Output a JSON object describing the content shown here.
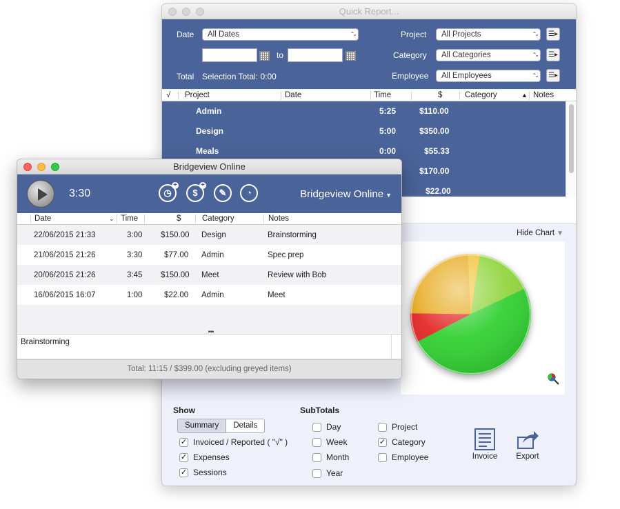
{
  "quick_report": {
    "title": "Quick Report...",
    "filters": {
      "date_label": "Date",
      "date_value": "All Dates",
      "to_label": "to",
      "total_label": "Total",
      "selection_total": "Selection Total: 0:00",
      "project_label": "Project",
      "project_value": "All Projects",
      "category_label": "Category",
      "category_value": "All Categories",
      "employee_label": "Employee",
      "employee_value": "All Employees"
    },
    "columns": {
      "check": "√",
      "project": "Project",
      "date": "Date",
      "time": "Time",
      "amount": "$",
      "category": "Category",
      "notes": "Notes"
    },
    "rows": [
      {
        "project": "Admin",
        "time": "5:25",
        "amount": "$110.00"
      },
      {
        "project": "Design",
        "time": "5:00",
        "amount": "$350.00"
      },
      {
        "project": "Meals",
        "time": "0:00",
        "amount": "$55.33"
      },
      {
        "project": "",
        "time": "",
        "amount": "$170.00"
      },
      {
        "project": "",
        "time": "",
        "amount": "$22.00"
      }
    ],
    "hide_chart": "Hide Chart",
    "chart_data": {
      "type": "pie",
      "values": [
        110,
        350,
        55.33,
        170,
        22
      ],
      "colors": [
        "#8fd43a",
        "#2ecf2e",
        "#e32222",
        "#e7a91a",
        "#f1c232"
      ]
    },
    "show": {
      "title": "Show",
      "summary": "Summary",
      "details": "Details",
      "invoiced": "Invoiced / Reported ( \"√\" )",
      "expenses": "Expenses",
      "sessions": "Sessions"
    },
    "subtotals": {
      "title": "SubTotals",
      "day": "Day",
      "week": "Week",
      "month": "Month",
      "year": "Year",
      "project": "Project",
      "category": "Category",
      "employee": "Employee"
    },
    "invoice_label": "Invoice",
    "export_label": "Export"
  },
  "bridgeview": {
    "title": "Bridgeview Online",
    "timer": "3:30",
    "project": "Bridgeview Online",
    "columns": {
      "date": "Date",
      "time": "Time",
      "amount": "$",
      "category": "Category",
      "notes": "Notes"
    },
    "rows": [
      {
        "date": "22/06/2015  21:33",
        "time": "3:00",
        "amount": "$150.00",
        "category": "Design",
        "notes": "Brainstorming"
      },
      {
        "date": "21/06/2015  21:26",
        "time": "3:30",
        "amount": "$77.00",
        "category": "Admin",
        "notes": "Spec prep"
      },
      {
        "date": "20/06/2015  21:26",
        "time": "3:45",
        "amount": "$150.00",
        "category": "Meet",
        "notes": "Review with Bob"
      },
      {
        "date": "16/06/2015  16:07",
        "time": "1:00",
        "amount": "$22.00",
        "category": "Admin",
        "notes": "Meet"
      }
    ],
    "notes_text": "Brainstorming",
    "footer": "Total: 11:15 / $399.00 (excluding greyed items)"
  }
}
